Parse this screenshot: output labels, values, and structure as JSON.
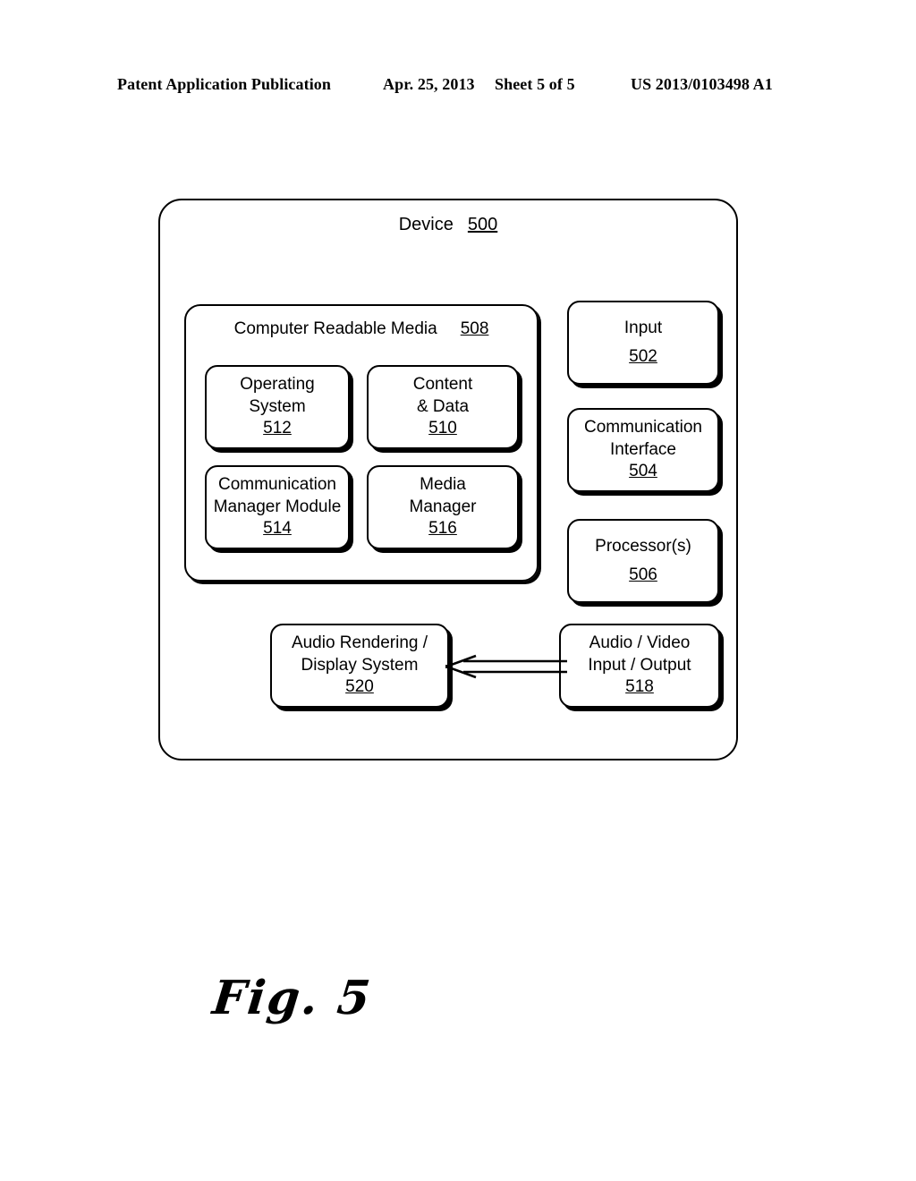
{
  "header": {
    "publication": "Patent Application Publication",
    "date": "Apr. 25, 2013",
    "sheet": "Sheet 5 of 5",
    "patent_number": "US 2013/0103498 A1"
  },
  "figure": {
    "caption": "Fig. 5",
    "device": {
      "label": "Device",
      "ref": "500"
    },
    "crm": {
      "label": "Computer Readable Media",
      "ref": "508"
    },
    "blocks": {
      "operating_system": {
        "line1": "Operating",
        "line2": "System",
        "ref": "512"
      },
      "content_data": {
        "line1": "Content",
        "line2": "& Data",
        "ref": "510"
      },
      "comm_manager": {
        "line1": "Communication",
        "line2": "Manager Module",
        "ref": "514"
      },
      "media_manager": {
        "line1": "Media",
        "line2": "Manager",
        "ref": "516"
      },
      "input": {
        "line1": "Input",
        "ref": "502"
      },
      "comm_interface": {
        "line1": "Communication",
        "line2": "Interface",
        "ref": "504"
      },
      "processors": {
        "line1": "Processor(s)",
        "ref": "506"
      },
      "audio_render": {
        "line1": "Audio Rendering /",
        "line2": "Display System",
        "ref": "520"
      },
      "audio_video_io": {
        "line1": "Audio / Video",
        "line2": "Input / Output",
        "ref": "518"
      }
    },
    "connector": {
      "name": "arrow-from-audio-video-io-to-audio-rendering",
      "direction": "left"
    }
  },
  "colors": {
    "ink": "#000000",
    "paper": "#ffffff"
  }
}
